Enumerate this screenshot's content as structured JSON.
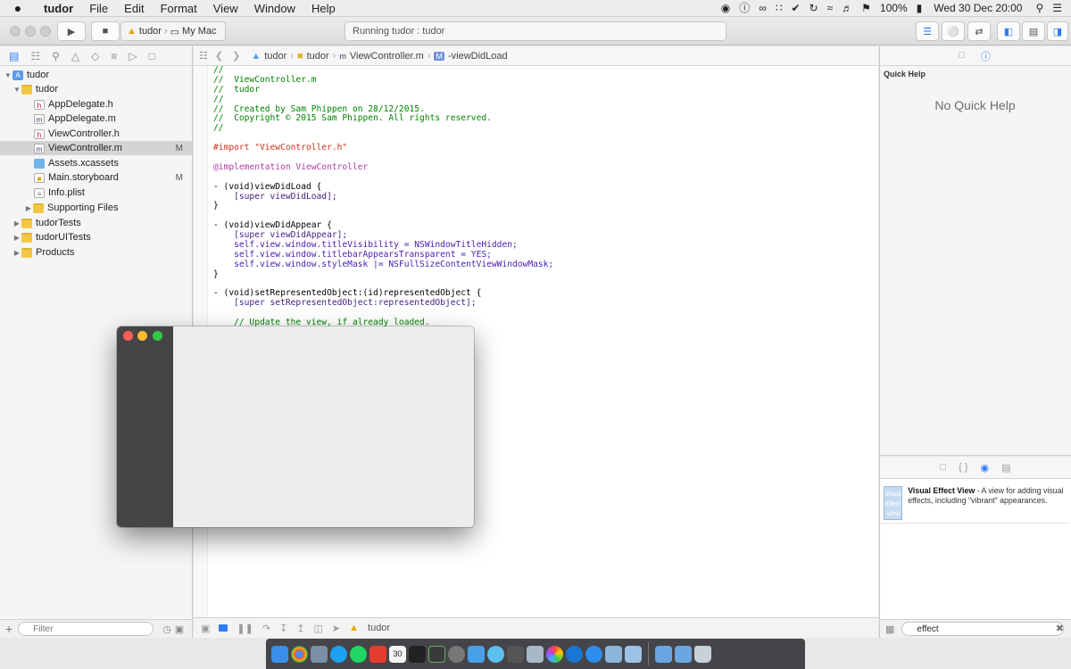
{
  "menubar": {
    "apple": "",
    "app_name": "tudor",
    "items": [
      "File",
      "Edit",
      "Format",
      "View",
      "Window",
      "Help"
    ],
    "battery": "100%",
    "datetime": "Wed 30 Dec  20:00"
  },
  "toolbar": {
    "scheme_target": "tudor",
    "scheme_device": "My Mac",
    "activity": "Running tudor : tudor"
  },
  "navigator": {
    "tree": [
      {
        "label": "tudor",
        "kind": "project",
        "expanded": true
      },
      {
        "label": "tudor",
        "kind": "folder",
        "expanded": true
      },
      {
        "label": "AppDelegate.h",
        "kind": "h"
      },
      {
        "label": "AppDelegate.m",
        "kind": "m"
      },
      {
        "label": "ViewController.h",
        "kind": "h"
      },
      {
        "label": "ViewController.m",
        "kind": "m",
        "status": "M",
        "selected": true
      },
      {
        "label": "Assets.xcassets",
        "kind": "assets"
      },
      {
        "label": "Main.storyboard",
        "kind": "storyboard",
        "status": "M"
      },
      {
        "label": "Info.plist",
        "kind": "plist"
      },
      {
        "label": "Supporting Files",
        "kind": "folder",
        "expanded": false
      },
      {
        "label": "tudorTests",
        "kind": "folder",
        "expanded": false
      },
      {
        "label": "tudorUITests",
        "kind": "folder",
        "expanded": false
      },
      {
        "label": "Products",
        "kind": "folder",
        "expanded": false
      }
    ],
    "filter_placeholder": "Filter"
  },
  "jumpbar": {
    "project": "tudor",
    "group": "tudor",
    "file": "ViewController.m",
    "method": "-viewDidLoad"
  },
  "editor": {
    "lines": [
      "//",
      "//  ViewController.m",
      "//  tudor",
      "//",
      "//  Created by Sam Phippen on 28/12/2015.",
      "//  Copyright © 2015 Sam Phippen. All rights reserved.",
      "//",
      "",
      "#import \"ViewController.h\"",
      "",
      "@implementation ViewController",
      "",
      "- (void)viewDidLoad {",
      "    [super viewDidLoad];",
      "}",
      "",
      "- (void)viewDidAppear {",
      "    [super viewDidAppear];",
      "    self.view.window.titleVisibility = NSWindowTitleHidden;",
      "    self.view.window.titlebarAppearsTransparent = YES;",
      "    self.view.window.styleMask |= NSFullSizeContentViewWindowMask;",
      "}",
      "",
      "- (void)setRepresentedObject:(id)representedObject {",
      "    [super setRepresentedObject:representedObject];",
      "",
      "    // Update the view, if already loaded."
    ]
  },
  "debugbar": {
    "target": "tudor"
  },
  "quick_help": {
    "title": "Quick Help",
    "empty_text": "No Quick Help"
  },
  "library": {
    "item_title": "Visual Effect View",
    "item_desc": " - A view for adding visual effects, including \"vibrant\" appearances.",
    "thumb_text": "Visual Effect View",
    "search_value": "effect"
  },
  "dock": {
    "calendar_day": "30"
  },
  "colors": {
    "comment": "#008400",
    "keyword": "#ad3da4",
    "string": "#d12f1b",
    "selection": "#d4d4d4",
    "accent": "#2e7cf6"
  }
}
